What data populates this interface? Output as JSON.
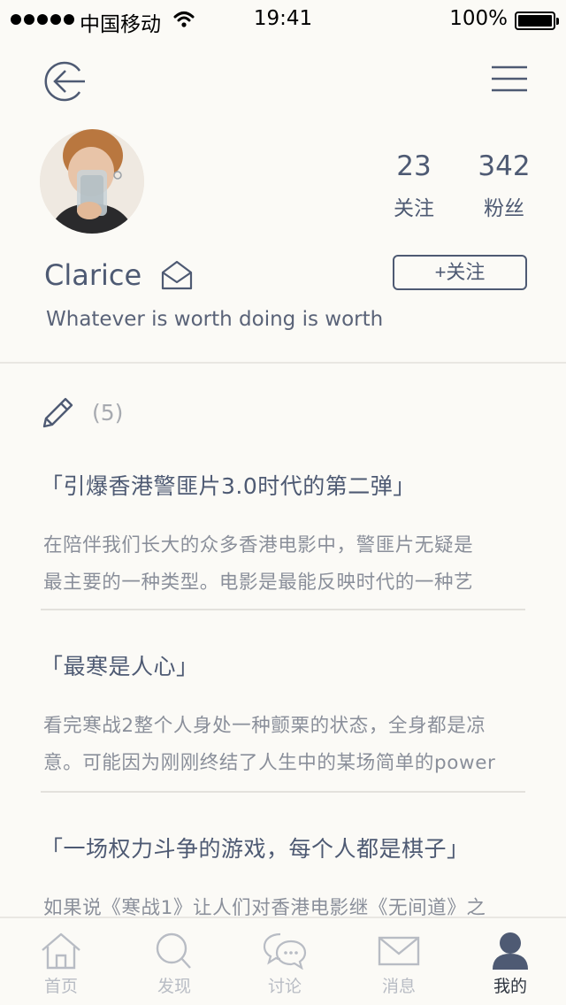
{
  "status_bar": {
    "carrier": "中国移动",
    "time": "19:41",
    "battery": "100%"
  },
  "profile": {
    "name": "Clarice",
    "bio": "Whatever is worth doing is worth",
    "following_count": "23",
    "following_label": "关注",
    "fans_count": "342",
    "fans_label": "粉丝",
    "follow_button": "+关注"
  },
  "posts": {
    "count_text": "(5)",
    "items": [
      {
        "title": "「引爆香港警匪片3.0时代的第二弹」",
        "line1": "在陪伴我们长大的众多香港电影中，警匪片无疑是",
        "line2": "最主要的一种类型。电影是最能反映时代的一种艺"
      },
      {
        "title": "「最寒是人心」",
        "line1": "看完寒战2整个人身处一种颤栗的状态，全身都是凉",
        "line2": "意。可能因为刚刚终结了人生中的某场简单的power"
      },
      {
        "title": "「一场权力斗争的游戏，每个人都是棋子」",
        "line1": "如果说《寒战1》让人们对香港电影继《无间道》之",
        "line2": ""
      }
    ]
  },
  "tab_bar": {
    "tabs": [
      {
        "label": "首页",
        "icon": "home-icon"
      },
      {
        "label": "发现",
        "icon": "search-icon"
      },
      {
        "label": "讨论",
        "icon": "chat-bubbles-icon"
      },
      {
        "label": "消息",
        "icon": "envelope-icon"
      },
      {
        "label": "我的",
        "icon": "person-icon"
      }
    ],
    "active": "我的"
  },
  "colors": {
    "background": "#fbfaf6",
    "primary_text": "#4e5a73",
    "muted_text": "#8a8f9a",
    "inactive_tab": "#b8bcc4"
  }
}
